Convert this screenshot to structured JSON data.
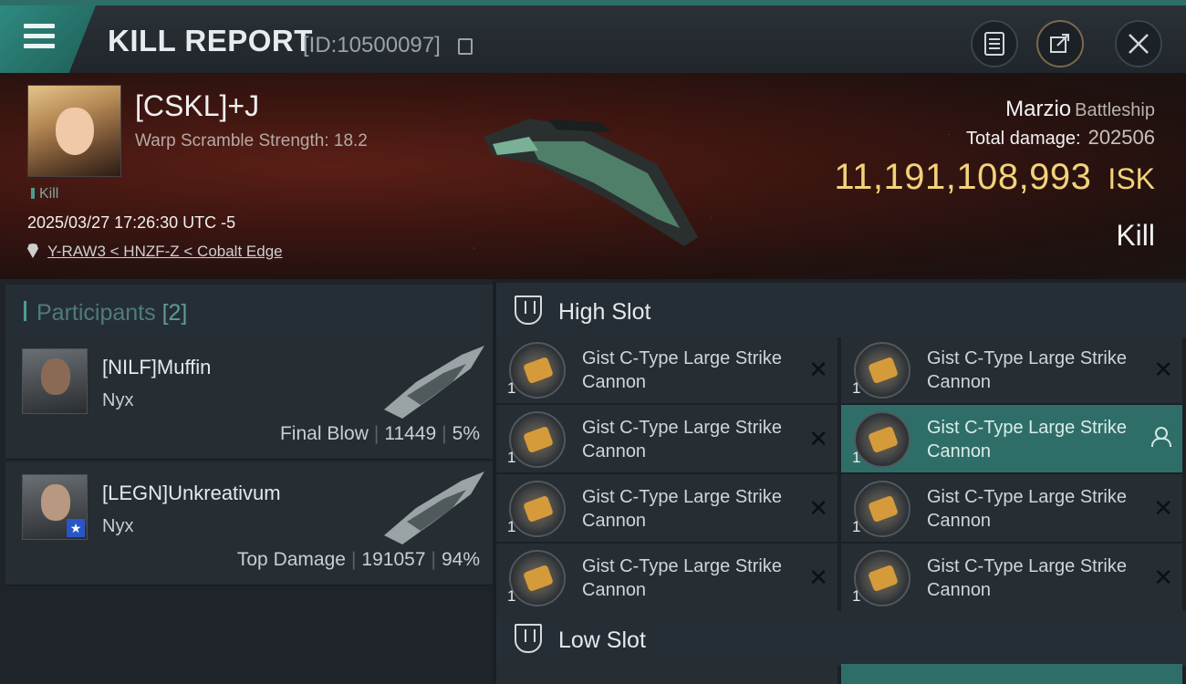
{
  "header": {
    "title": "KILL REPORT",
    "report_id": "[ID:10500097]",
    "icons": [
      "menu-icon",
      "copy-icon",
      "report-icon",
      "share-icon",
      "close-icon"
    ]
  },
  "victim": {
    "name": "[CSKL]+J",
    "scramble": "Warp Scramble Strength: 18.2",
    "tag": "Kill",
    "datetime": "2025/03/27 17:26:30 UTC -5",
    "location": "Y-RAW3 < HNZF-Z < Cobalt Edge",
    "ship_name": "Marzio",
    "ship_class": "Battleship",
    "total_damage_label": "Total damage:",
    "total_damage": "202506",
    "isk_amount": "11,191,108,993",
    "isk_unit": "ISK",
    "result": "Kill"
  },
  "participants": {
    "label": "Participants",
    "count": "[2]",
    "items": [
      {
        "name": "[NILF]Muffin",
        "ship": "Nyx",
        "role": "Final Blow",
        "damage": "11449",
        "percent": "5%"
      },
      {
        "name": "[LEGN]Unkreativum",
        "ship": "Nyx",
        "role": "Top Damage",
        "damage": "191057",
        "percent": "94%"
      }
    ]
  },
  "slots": {
    "high_label": "High Slot",
    "low_label": "Low Slot",
    "modules": [
      {
        "qty": "1",
        "name": "Gist C-Type Large Strike Cannon",
        "state": "destroyed"
      },
      {
        "qty": "1",
        "name": "Gist C-Type Large Strike Cannon",
        "state": "destroyed"
      },
      {
        "qty": "1",
        "name": "Gist C-Type Large Strike Cannon",
        "state": "destroyed"
      },
      {
        "qty": "1",
        "name": "Gist C-Type Large Strike Cannon",
        "state": "dropped"
      },
      {
        "qty": "1",
        "name": "Gist C-Type Large Strike Cannon",
        "state": "destroyed"
      },
      {
        "qty": "1",
        "name": "Gist C-Type Large Strike Cannon",
        "state": "destroyed"
      },
      {
        "qty": "1",
        "name": "Gist C-Type Large Strike Cannon",
        "state": "destroyed"
      },
      {
        "qty": "1",
        "name": "Gist C-Type Large Strike Cannon",
        "state": "destroyed"
      }
    ]
  },
  "colors": {
    "accent": "#2f6e68",
    "isk": "#f3d27a"
  }
}
